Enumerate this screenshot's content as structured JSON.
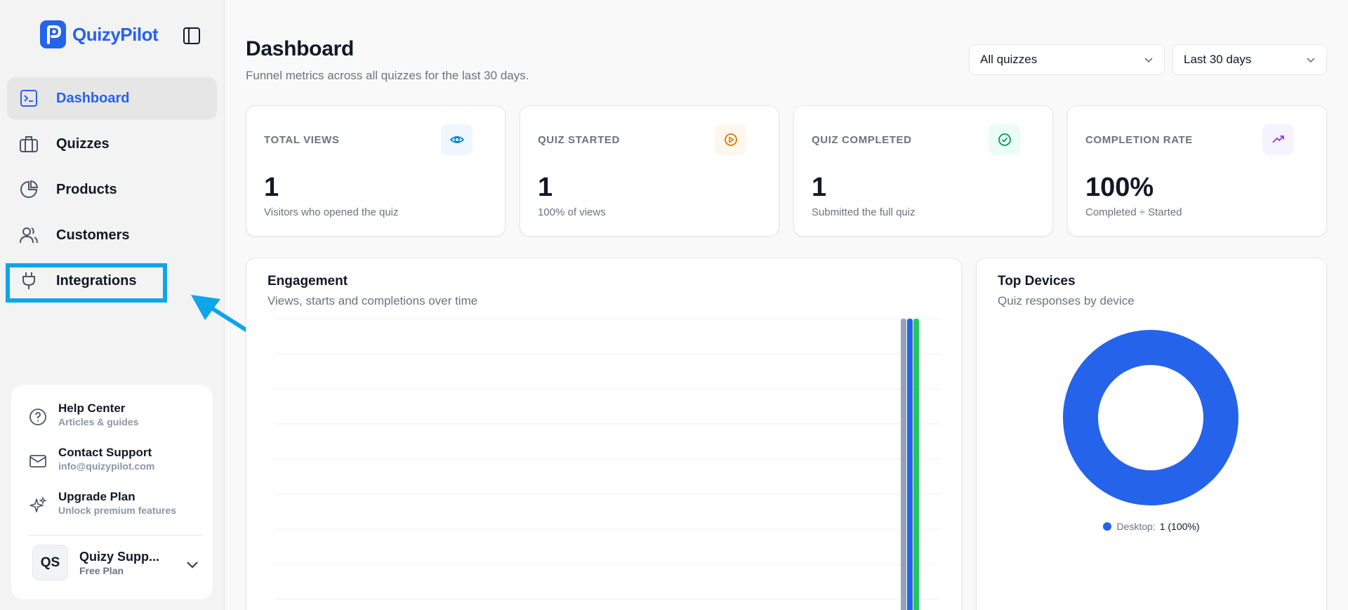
{
  "brand": {
    "name": "QuizyPilot"
  },
  "sidebar": {
    "items": [
      {
        "label": "Dashboard",
        "icon": "terminal-icon"
      },
      {
        "label": "Quizzes",
        "icon": "briefcase-icon"
      },
      {
        "label": "Products",
        "icon": "pie-chart-icon"
      },
      {
        "label": "Customers",
        "icon": "users-icon"
      },
      {
        "label": "Integrations",
        "icon": "plug-icon"
      }
    ],
    "active": "Dashboard",
    "help": [
      {
        "title": "Help Center",
        "subtitle": "Articles & guides",
        "icon": "help-circle-icon"
      },
      {
        "title": "Contact Support",
        "subtitle": "info@quizypilot.com",
        "icon": "mail-icon"
      },
      {
        "title": "Upgrade Plan",
        "subtitle": "Unlock premium features",
        "icon": "sparkles-icon"
      }
    ],
    "account": {
      "initials": "QS",
      "name": "Quizy Supp...",
      "plan": "Free Plan"
    }
  },
  "header": {
    "title": "Dashboard",
    "subtitle": "Funnel metrics across all quizzes for the last 30 days.",
    "quiz_filter": "All quizzes",
    "range_filter": "Last 30 days"
  },
  "stats": [
    {
      "label": "TOTAL VIEWS",
      "value": "1",
      "desc": "Visitors who opened the quiz",
      "icon": "eye-icon",
      "color": "#0284c7",
      "bg": "#eff6ff"
    },
    {
      "label": "QUIZ STARTED",
      "value": "1",
      "desc": "100% of views",
      "icon": "play-circle-icon",
      "color": "#d97706",
      "bg": "#fff7ed"
    },
    {
      "label": "QUIZ COMPLETED",
      "value": "1",
      "desc": "Submitted the full quiz",
      "icon": "check-circle-icon",
      "color": "#059669",
      "bg": "#ecfdf5"
    },
    {
      "label": "COMPLETION RATE",
      "value": "100%",
      "desc": "Completed ÷ Started",
      "icon": "trending-up-icon",
      "color": "#9333ea",
      "bg": "#f5f3ff"
    }
  ],
  "engagement": {
    "title": "Engagement",
    "subtitle": "Views, starts and completions over time"
  },
  "devices": {
    "title": "Top Devices",
    "subtitle": "Quiz responses by device",
    "legend_label": "Desktop:",
    "legend_value": "1 (100%)"
  },
  "colors": {
    "accent": "#2563eb",
    "highlight": "#0ea5e9",
    "series_views": "#94a3b8",
    "series_starts": "#2563eb",
    "series_completions": "#22c55e"
  },
  "chart_data": [
    {
      "type": "bar",
      "title": "Engagement",
      "subtitle": "Views, starts and completions over time",
      "series": [
        {
          "values": [
            1
          ]
        },
        {
          "values": [
            1
          ]
        },
        {
          "values": [
            1
          ]
        }
      ],
      "grid": true
    },
    {
      "type": "pie",
      "title": "Top Devices",
      "subtitle": "Quiz responses by device",
      "categories": [
        "Desktop"
      ],
      "values": [
        1
      ],
      "legend": "bottom"
    }
  ]
}
